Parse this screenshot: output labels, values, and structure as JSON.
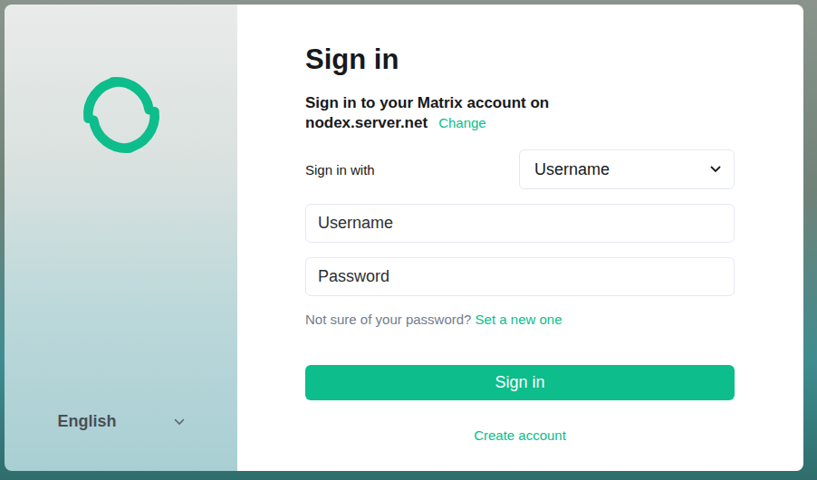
{
  "page": {
    "title": "Sign in",
    "subtitle": "Sign in to your Matrix account on",
    "server": "nodex.server.net",
    "change_link": "Change"
  },
  "sign_in_with": {
    "label": "Sign in with",
    "value": "Username"
  },
  "fields": [
    {
      "placeholder": "Username",
      "type": "text"
    },
    {
      "placeholder": "Password",
      "type": "password"
    }
  ],
  "forgot": {
    "text": "Not sure of your password?",
    "link": "Set a new one"
  },
  "submit": "Sign in",
  "create_account": "Create account",
  "language": "English"
}
